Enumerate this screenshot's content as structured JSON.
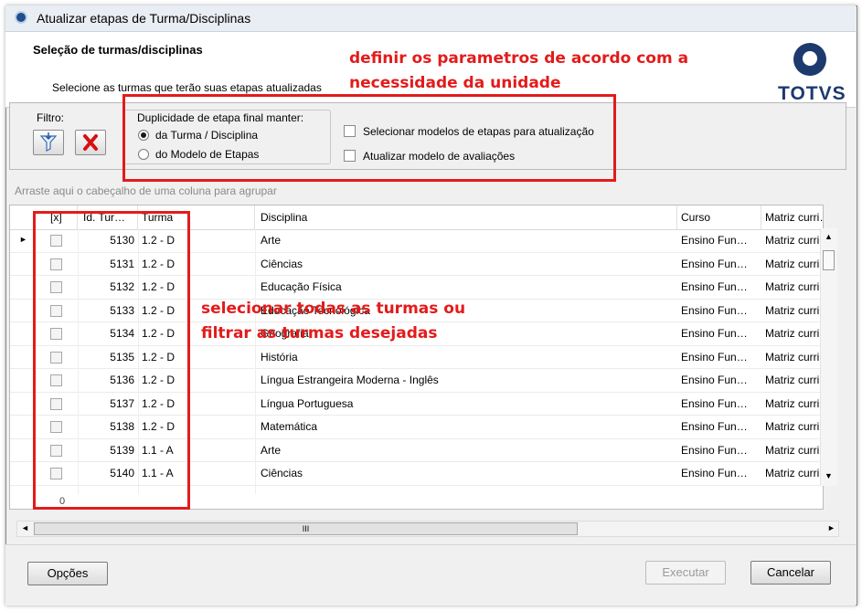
{
  "window": {
    "title": "Atualizar etapas de Turma/Disciplinas"
  },
  "header": {
    "section_title": "Seleção de turmas/disciplinas",
    "subtitle": "Selecione as turmas que terão suas etapas atualizadas",
    "logo_text": "TOTVS"
  },
  "annotations": {
    "top_line1": "definir os parametros de acordo com a",
    "top_line2": "necessidade da unidade",
    "mid_line1": "selecionar todas as turmas ou",
    "mid_line2": "filtrar as turmas desejadas"
  },
  "filter": {
    "label": "Filtro:",
    "duplicidade": {
      "legend": "Duplicidade de etapa final manter:",
      "options": [
        {
          "label": "da Turma / Disciplina",
          "selected": true
        },
        {
          "label": "do Modelo de Etapas",
          "selected": false
        }
      ]
    },
    "check_modelos": "Selecionar modelos de etapas para atualização",
    "check_avaliacoes": "Atualizar modelo de avaliações"
  },
  "grid": {
    "group_hint": "Arraste aqui o cabeçalho de uma coluna para agrupar",
    "columns": [
      "[x]",
      "Id. Tur…",
      "Turma",
      "Disciplina",
      "Curso",
      "Matriz curri…"
    ],
    "rows": [
      {
        "id": "5130",
        "turma": "1.2 - D",
        "disciplina": "Arte",
        "curso": "Ensino Fun…",
        "matriz": "Matriz curri"
      },
      {
        "id": "5131",
        "turma": "1.2 - D",
        "disciplina": "Ciências",
        "curso": "Ensino Fun…",
        "matriz": "Matriz curri"
      },
      {
        "id": "5132",
        "turma": "1.2 - D",
        "disciplina": "Educação Física",
        "curso": "Ensino Fun…",
        "matriz": "Matriz curri"
      },
      {
        "id": "5133",
        "turma": "1.2 - D",
        "disciplina": "Educação Tecnológica",
        "curso": "Ensino Fun…",
        "matriz": "Matriz curri"
      },
      {
        "id": "5134",
        "turma": "1.2 - D",
        "disciplina": "Geografia",
        "curso": "Ensino Fun…",
        "matriz": "Matriz curri"
      },
      {
        "id": "5135",
        "turma": "1.2 - D",
        "disciplina": "História",
        "curso": "Ensino Fun…",
        "matriz": "Matriz curri"
      },
      {
        "id": "5136",
        "turma": "1.2 - D",
        "disciplina": "Língua Estrangeira Moderna - Inglês",
        "curso": "Ensino Fun…",
        "matriz": "Matriz curri"
      },
      {
        "id": "5137",
        "turma": "1.2 - D",
        "disciplina": "Língua Portuguesa",
        "curso": "Ensino Fun…",
        "matriz": "Matriz curri"
      },
      {
        "id": "5138",
        "turma": "1.2 - D",
        "disciplina": "Matemática",
        "curso": "Ensino Fun…",
        "matriz": "Matriz curri"
      },
      {
        "id": "5139",
        "turma": "1.1 - A",
        "disciplina": "Arte",
        "curso": "Ensino Fun…",
        "matriz": "Matriz curri"
      },
      {
        "id": "5140",
        "turma": "1.1 - A",
        "disciplina": "Ciências",
        "curso": "Ensino Fun…",
        "matriz": "Matriz curri"
      }
    ],
    "footer_count": "0",
    "scroll_thumb": "III"
  },
  "buttons": {
    "opcoes": "Opções",
    "executar": "Executar",
    "cancelar": "Cancelar"
  },
  "colors": {
    "annotation_red": "#e31b1b",
    "logo_blue": "#1d3a6f"
  }
}
